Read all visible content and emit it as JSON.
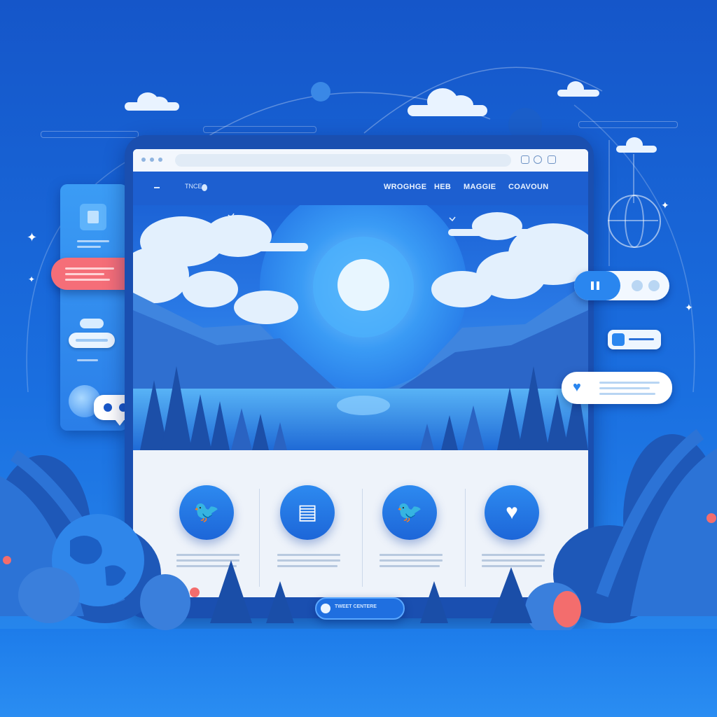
{
  "colors": {
    "background": "#1a6fe0",
    "accent": "#2a86ef",
    "coral": "#f56e78",
    "card": "#eef3fa"
  },
  "browser": {
    "url": "",
    "site": {
      "logo_text": "TNCE",
      "nav": [
        {
          "label": "WROGHGE"
        },
        {
          "label": "HEB"
        },
        {
          "label": "MAGGIE"
        },
        {
          "label": "COAVOUN"
        }
      ]
    },
    "features": [
      {
        "icon": "bird-icon",
        "glyph": "🐦"
      },
      {
        "icon": "document-icon",
        "glyph": "▤"
      },
      {
        "icon": "bird-icon",
        "glyph": "🐦"
      },
      {
        "icon": "heart-icon",
        "glyph": "♥"
      }
    ],
    "cta_label": "TWEET CENTERE"
  },
  "widgets": {
    "right_card_icon": "heart-icon",
    "chat_icon": "chat-bubble-icon"
  }
}
